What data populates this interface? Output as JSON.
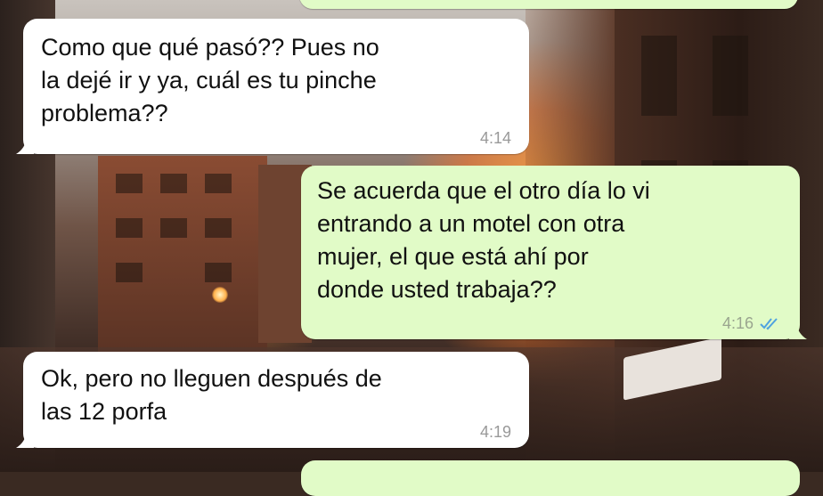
{
  "messages": [
    {
      "direction": "outgoing",
      "text": "",
      "time": ""
    },
    {
      "direction": "incoming",
      "text": "Como que qué pasó?? Pues no\nla dejé ir y ya, cuál es tu pinche\nproblema??",
      "time": "4:14"
    },
    {
      "direction": "outgoing",
      "text": "Se acuerda que el otro día lo vi\nentrando a un motel con otra\nmujer, el que está ahí por\ndonde usted trabaja??",
      "time": "4:16",
      "status": "read-double-check-icon",
      "status_color": "#4fa3e0"
    },
    {
      "direction": "incoming",
      "text": "Ok, pero no lleguen después de\nlas 12 porfa",
      "time": "4:19"
    },
    {
      "direction": "outgoing",
      "text": "",
      "time": ""
    }
  ],
  "colors": {
    "incoming_bubble": "#ffffff",
    "outgoing_bubble": "#e1fbc7",
    "timestamp": "#999999",
    "read_ticks": "#4fa3e0"
  }
}
